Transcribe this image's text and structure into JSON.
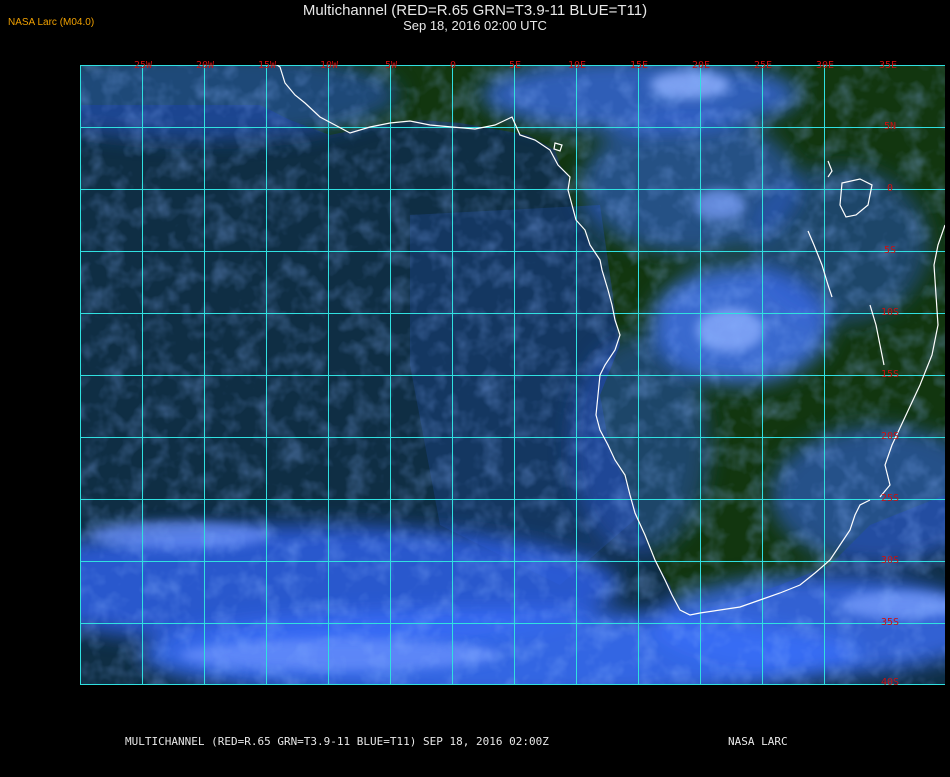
{
  "header": {
    "title": "Multichannel (RED=R.65 GRN=T3.9-11 BLUE=T11)",
    "subtitle": "Sep 18, 2016 02:00 UTC",
    "source": "NASA Larc (M04.0)"
  },
  "footer": {
    "left_text": "MULTICHANNEL (RED=R.65 GRN=T3.9-11 BLUE=T11) SEP 18, 2016 02:00Z",
    "right_text": "NASA LARC"
  },
  "map": {
    "longitude_labels": [
      "25W",
      "20W",
      "15W",
      "10W",
      "5W",
      "0",
      "5E",
      "10E",
      "15E",
      "20E",
      "25E",
      "30E",
      "35E"
    ],
    "latitude_labels": [
      "5N",
      "0",
      "5S",
      "10S",
      "15S",
      "20S",
      "25S",
      "30S",
      "35S",
      "40S"
    ],
    "colors": {
      "land": "#12360f",
      "ocean": "#10305a",
      "cloud": "#3f78ff",
      "cloud_bright": "#8fb0ff",
      "grid": "#30e0e0",
      "coastline": "#ffffff",
      "label": "#cc1010"
    }
  }
}
